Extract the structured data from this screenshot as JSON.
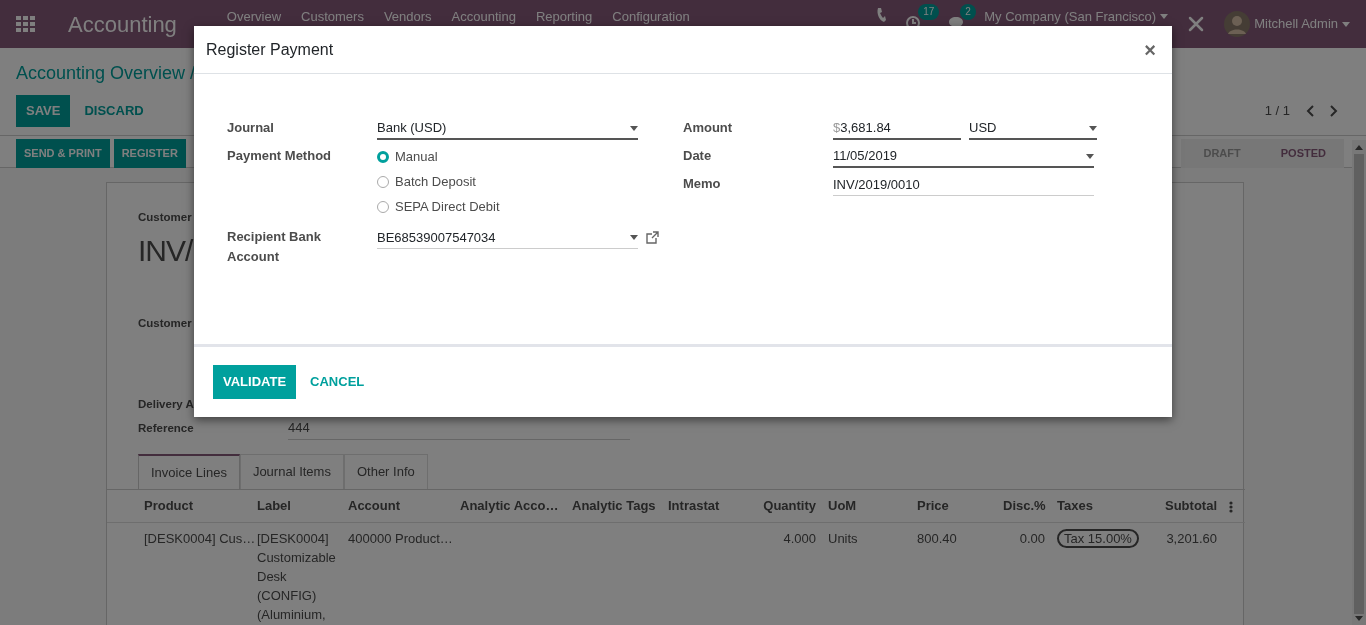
{
  "navbar": {
    "brand": "Accounting",
    "menu": [
      "Overview",
      "Customers",
      "Vendors",
      "Accounting",
      "Reporting",
      "Configuration"
    ],
    "activity_badge": "17",
    "message_badge": "2",
    "company": "My Company (San Francisco)",
    "user": "Mitchell Admin"
  },
  "breadcrumb": "Accounting Overview /",
  "edit_buttons": [
    {
      "label": "SAVE",
      "kind": "primary"
    },
    {
      "label": "DISCARD",
      "kind": "link"
    }
  ],
  "pager": "1 / 1",
  "action_buttons": [
    "SEND & PRINT",
    "REGISTER"
  ],
  "statuses": [
    {
      "label": "DRAFT",
      "selected": false
    },
    {
      "label": "POSTED",
      "selected": true
    }
  ],
  "sheet": {
    "caption": "Customer",
    "title": "INV/",
    "fields": [
      {
        "label": "Customer"
      },
      {
        "label": "Delivery A"
      },
      {
        "label": "Reference",
        "value": "444"
      }
    ],
    "tabs": [
      {
        "label": "Invoice Lines",
        "selected": true
      },
      {
        "label": "Journal Items",
        "selected": false
      },
      {
        "label": "Other Info",
        "selected": false
      }
    ],
    "table": {
      "columns": [
        "Product",
        "Label",
        "Account",
        "Analytic Acco…",
        "Analytic Tags",
        "Intrastat",
        "Quantity",
        "UoM",
        "Price",
        "Disc.%",
        "Taxes",
        "Subtotal"
      ],
      "rows": [
        {
          "product": "[DESK0004] Cus…",
          "label": "[DESK0004] Customizable Desk (CONFIG) (Aluminium,",
          "account": "400000 Product…",
          "quantity": "4.000",
          "uom": "Units",
          "price": "800.40",
          "discount": "0.00",
          "taxes": [
            "Tax 15.00%"
          ],
          "subtotal": "3,201.60"
        }
      ]
    }
  },
  "dialog": {
    "title": "Register Payment",
    "close": "×",
    "left_fields": [
      {
        "label": "Journal",
        "kind": "select",
        "value": "Bank (USD)",
        "required": true
      },
      {
        "label": "Payment Method",
        "kind": "radio",
        "options": [
          {
            "label": "Manual",
            "selected": true
          },
          {
            "label": "Batch Deposit",
            "selected": false
          },
          {
            "label": "SEPA Direct Debit",
            "selected": false
          }
        ]
      },
      {
        "label": "Recipient Bank Account",
        "kind": "select",
        "value": "BE68539007547034",
        "required": false,
        "external_link": true
      }
    ],
    "right_fields": [
      {
        "label": "Amount",
        "kind": "amount",
        "currency_symbol": "$",
        "value": "3,681.84",
        "currency": "USD",
        "required": true
      },
      {
        "label": "Date",
        "kind": "select",
        "value": "11/05/2019",
        "required": true
      },
      {
        "label": "Memo",
        "kind": "text",
        "value": "INV/2019/0010",
        "required": false
      }
    ],
    "buttons": [
      {
        "label": "VALIDATE",
        "kind": "primary"
      },
      {
        "label": "CANCEL",
        "kind": "link"
      }
    ]
  }
}
